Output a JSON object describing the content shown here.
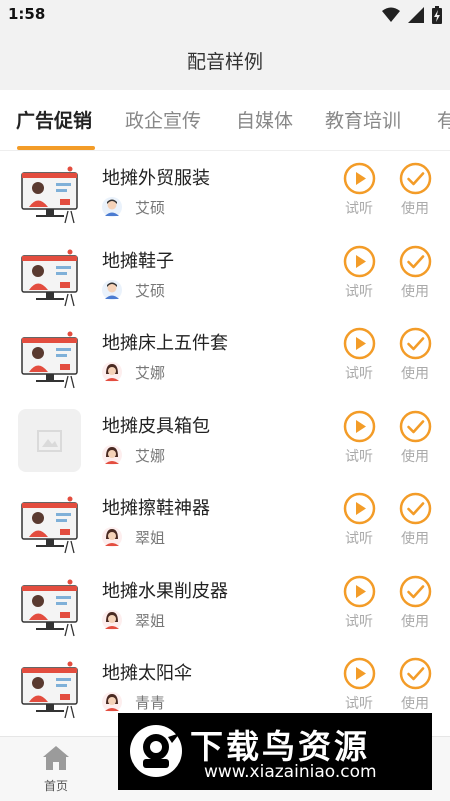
{
  "status": {
    "time": "1:58"
  },
  "header": {
    "title": "配音样例"
  },
  "tabs": [
    {
      "label": "广告促销",
      "active": true
    },
    {
      "label": "政企宣传",
      "active": false
    },
    {
      "label": "自媒体",
      "active": false
    },
    {
      "label": "教育培训",
      "active": false
    },
    {
      "label": "有",
      "active": false
    }
  ],
  "actions": {
    "listen_label": "试听",
    "use_label": "使用"
  },
  "items": [
    {
      "title": "地摊外贸服装",
      "author": "艾硕",
      "avatar": "male"
    },
    {
      "title": "地摊鞋子",
      "author": "艾硕",
      "avatar": "male"
    },
    {
      "title": "地摊床上五件套",
      "author": "艾娜",
      "avatar": "female"
    },
    {
      "title": "地摊皮具箱包",
      "author": "艾娜",
      "avatar": "female",
      "thumb": "placeholder"
    },
    {
      "title": "地摊擦鞋神器",
      "author": "翠姐",
      "avatar": "female"
    },
    {
      "title": "地摊水果削皮器",
      "author": "翠姐",
      "avatar": "female"
    },
    {
      "title": "地摊太阳伞",
      "author": "青青",
      "avatar": "female"
    }
  ],
  "bottom_nav": {
    "items": [
      {
        "label": "首页"
      }
    ]
  },
  "watermark": {
    "title": "下载鸟资源",
    "url": "www.xiazainiao.com"
  },
  "colors": {
    "accent": "#f39c28",
    "header_bg": "#f2f2f2",
    "watermark_bg": "#000000"
  }
}
